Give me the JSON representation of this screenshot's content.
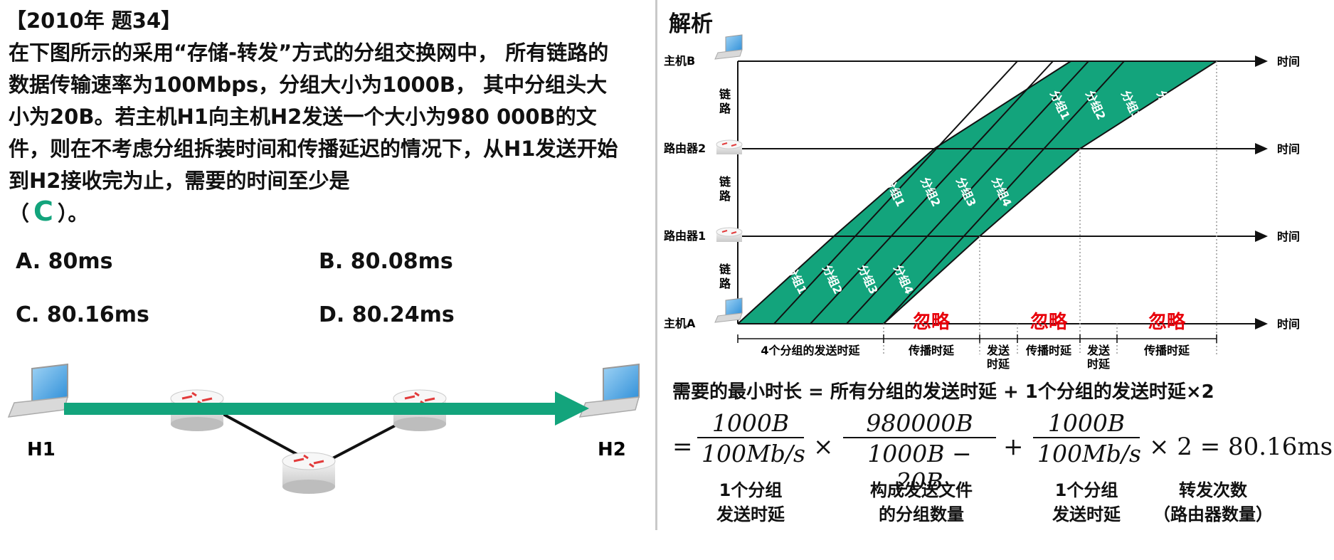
{
  "question": {
    "header": "【2010年 题34】",
    "body": "在下图所示的采用“存储-转发”方式的分组交换网中， 所有链路的数据传输速率为100Mbps，分组大小为1000B， 其中分组头大小为20B。若主机H1向主机H2发送一个大小为980 000B的文件，则在不考虑分组拆装时间和传播延迟的情况下，从H1发送开始到H2接收完为止，需要的时间至少是",
    "answer_open": "（",
    "answer": "C",
    "answer_close": "）。",
    "options": {
      "a": "A. 80ms",
      "b": "B. 80.08ms",
      "c": "C. 80.16ms",
      "d": "D. 80.24ms"
    },
    "network": {
      "h1": "H1",
      "h2": "H2"
    }
  },
  "analysis": {
    "title": "解析",
    "nodes": {
      "host_b": "主机B",
      "router2": "路由器2",
      "router1": "路由器1",
      "host_a": "主机A"
    },
    "time_label": "时间",
    "link_label": [
      "链",
      "路"
    ],
    "packets": [
      "分组1",
      "分组2",
      "分组3",
      "分组4"
    ],
    "ignore_label": "忽略",
    "intervals": {
      "send4": "4个分组的发送时延",
      "prop": "传播时延",
      "send_line1": "发送",
      "send_line2": "时延"
    },
    "summary": "需要的最小时长 = 所有分组的发送时延 + 1个分组的发送时延×2",
    "formula": {
      "eq": "=",
      "frac1_num": "1000B",
      "frac1_den": "100Mb/s",
      "times": "×",
      "frac2_num": "980000B",
      "frac2_den": "1000B − 20B",
      "plus": "+",
      "frac3_num": "1000B",
      "frac3_den": "100Mb/s",
      "tail": "× 2 = 80.16ms"
    },
    "captions": {
      "c1_l1": "1个分组",
      "c1_l2": "发送时延",
      "c2_l1": "构成发送文件",
      "c2_l2": "的分组数量",
      "c3_l1": "1个分组",
      "c3_l2": "发送时延",
      "c4_l1": "转发次数",
      "c4_l2": "（路由器数量）"
    }
  },
  "colors": {
    "band": "#13a47c",
    "accent": "#13a47c",
    "ignore": "#e8000b"
  }
}
